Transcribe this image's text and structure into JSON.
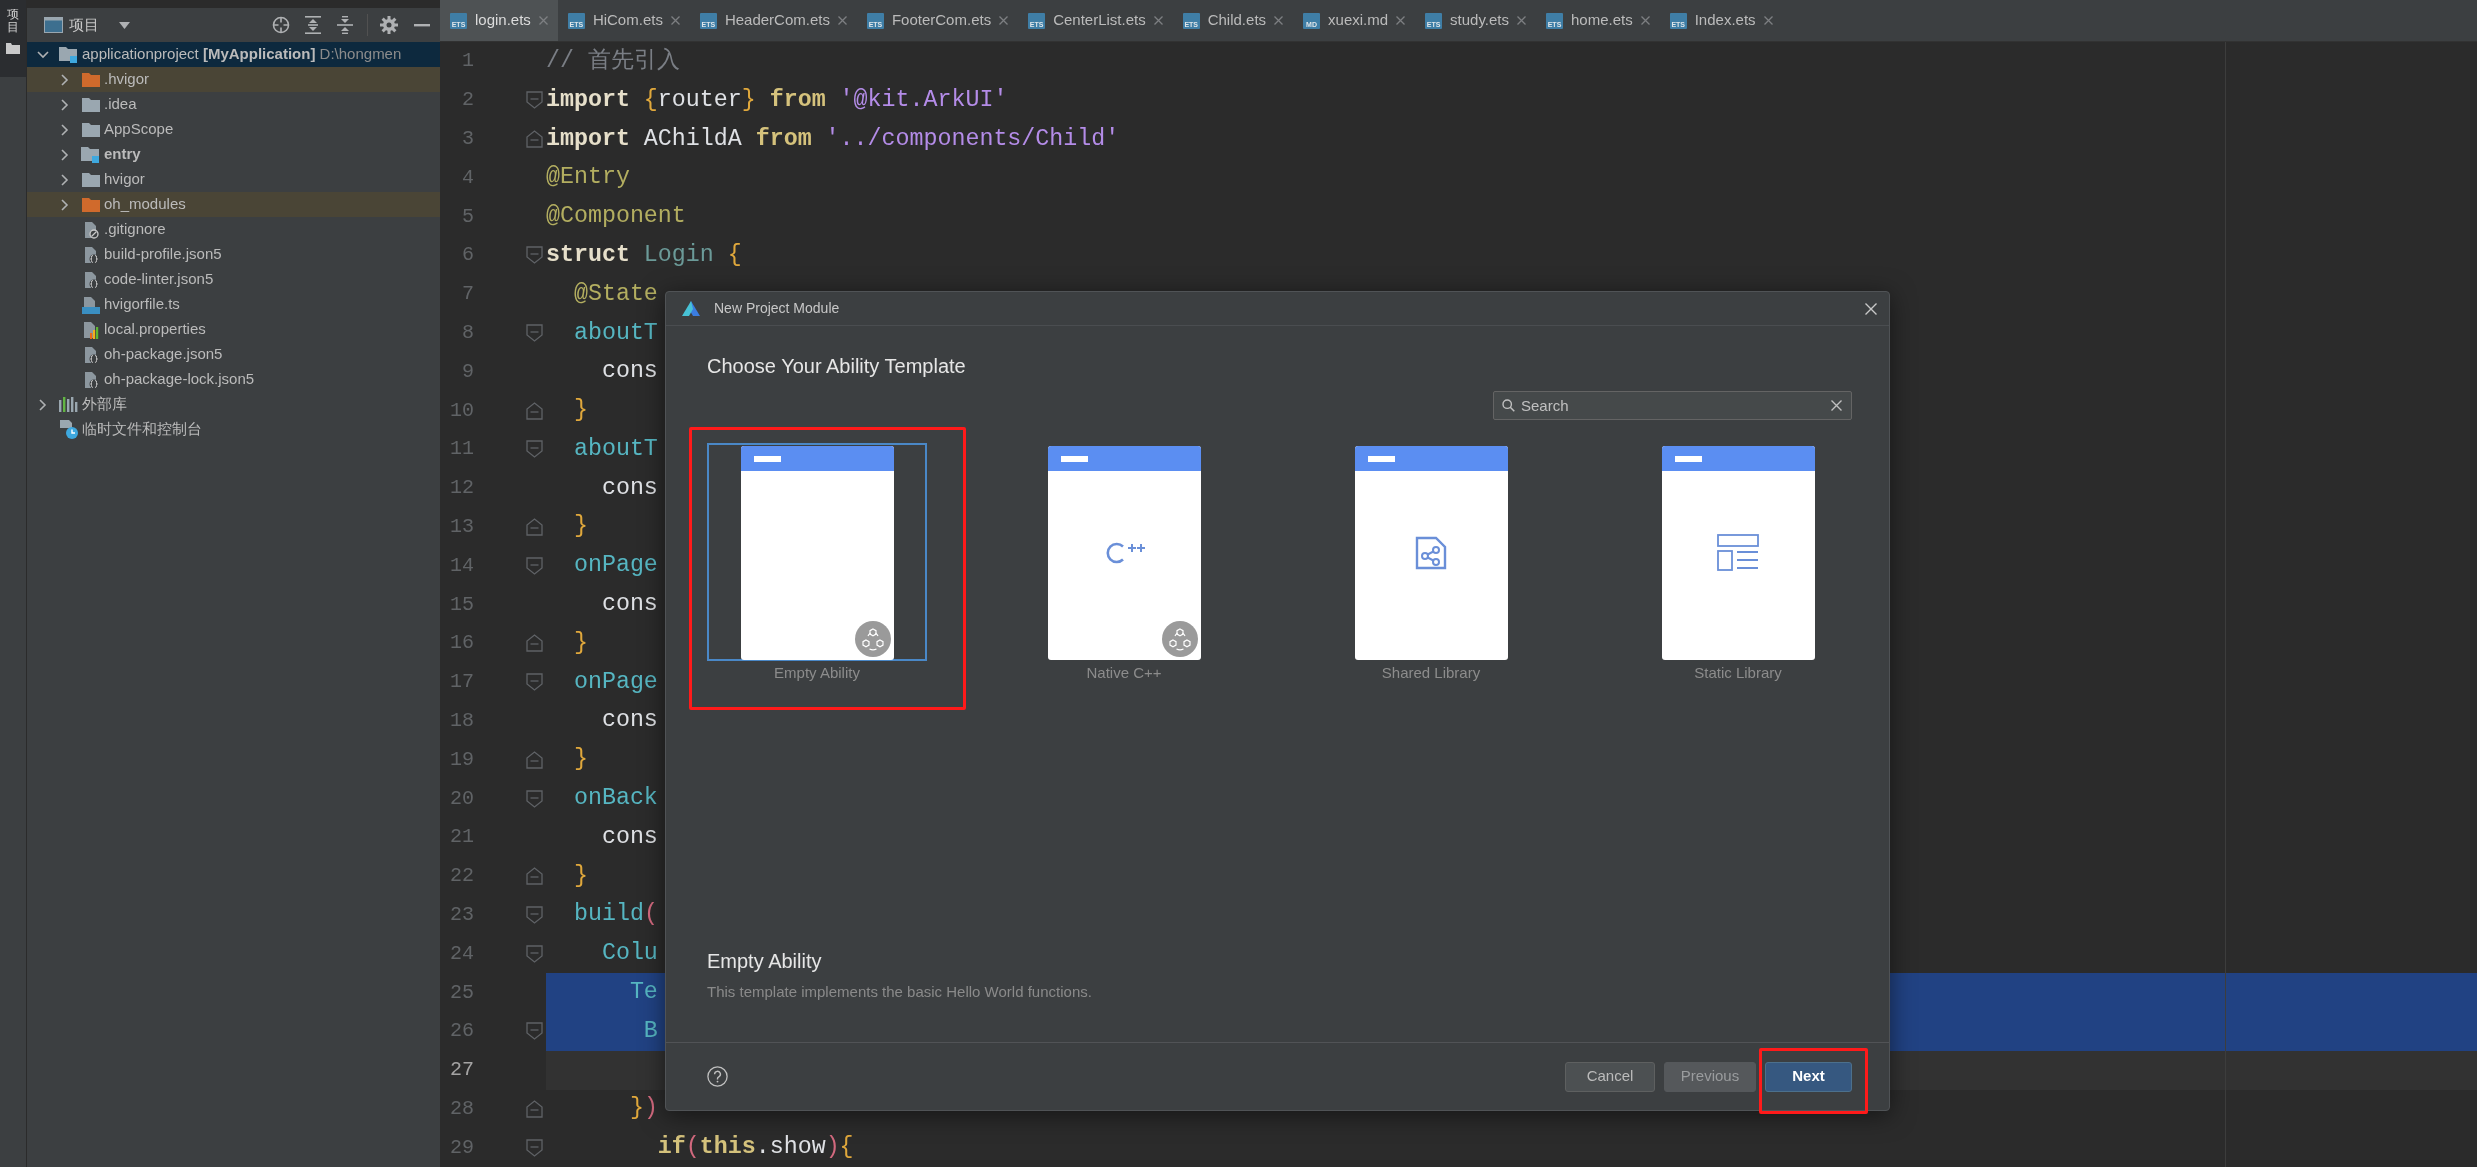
{
  "tool_strip": {
    "label": "项目",
    "selected": true
  },
  "project_panel": {
    "title": "项目",
    "tree": [
      {
        "name": "applicationproject",
        "module": "[MyApplication]",
        "path": "D:\\hongmen",
        "kind": "project",
        "expanded": true,
        "selected": true,
        "children": [
          {
            "name": ".hvigor",
            "kind": "excluded_folder",
            "expanded": false,
            "selected": false
          },
          {
            "name": ".idea",
            "kind": "folder",
            "expanded": false,
            "selected": false
          },
          {
            "name": "AppScope",
            "kind": "folder",
            "expanded": false,
            "selected": false
          },
          {
            "name": "entry",
            "kind": "module_folder",
            "expanded": false,
            "selected": false
          },
          {
            "name": "hvigor",
            "kind": "folder",
            "expanded": false,
            "selected": false
          },
          {
            "name": "oh_modules",
            "kind": "excluded_folder",
            "expanded": false,
            "selected": false
          },
          {
            "name": ".gitignore",
            "kind": "ignore_file",
            "selected": false
          },
          {
            "name": "build-profile.json5",
            "kind": "json_file",
            "selected": false
          },
          {
            "name": "code-linter.json5",
            "kind": "json_file",
            "selected": false
          },
          {
            "name": "hvigorfile.ts",
            "kind": "ts_file",
            "selected": false
          },
          {
            "name": "local.properties",
            "kind": "properties_file",
            "selected": false
          },
          {
            "name": "oh-package.json5",
            "kind": "json_file",
            "selected": false
          },
          {
            "name": "oh-package-lock.json5",
            "kind": "json_file",
            "selected": false
          }
        ]
      },
      {
        "name": "外部库",
        "kind": "library",
        "expanded": false,
        "selected": false
      },
      {
        "name": "临时文件和控制台",
        "kind": "scratch",
        "selected": false
      }
    ]
  },
  "tabs": [
    {
      "label": "login.ets",
      "type": "ETS",
      "selected": true
    },
    {
      "label": "HiCom.ets",
      "type": "ETS",
      "selected": false
    },
    {
      "label": "HeaderCom.ets",
      "type": "ETS",
      "selected": false
    },
    {
      "label": "FooterCom.ets",
      "type": "ETS",
      "selected": false
    },
    {
      "label": "CenterList.ets",
      "type": "ETS",
      "selected": false
    },
    {
      "label": "Child.ets",
      "type": "ETS",
      "selected": false
    },
    {
      "label": "xuexi.md",
      "type": "MD",
      "selected": false
    },
    {
      "label": "study.ets",
      "type": "ETS",
      "selected": false
    },
    {
      "label": "home.ets",
      "type": "ETS",
      "selected": false
    },
    {
      "label": "Index.ets",
      "type": "ETS",
      "selected": false
    }
  ],
  "code_lines": [
    {
      "number": "1",
      "kind": "plain",
      "current": false,
      "selected": false,
      "tokens": [
        {
          "text": "// 首先引入",
          "kind": "comment"
        }
      ]
    },
    {
      "number": "2",
      "kind": "fold_start",
      "current": false,
      "selected": false,
      "tokens": [
        {
          "text": "import",
          "kind": "keyword"
        },
        {
          "text": " {",
          "kind": "brace"
        },
        {
          "text": "router",
          "kind": "plain"
        },
        {
          "text": "}",
          "kind": "brace"
        },
        {
          "text": " from",
          "kind": "keyword_alt"
        },
        {
          "text": " '@kit.ArkUI'",
          "kind": "string"
        }
      ]
    },
    {
      "number": "3",
      "kind": "fold_end",
      "current": false,
      "selected": false,
      "tokens": [
        {
          "text": "import",
          "kind": "keyword"
        },
        {
          "text": " AChildA",
          "kind": "plain"
        },
        {
          "text": " from",
          "kind": "keyword_alt"
        },
        {
          "text": " '../components/Child'",
          "kind": "string"
        }
      ]
    },
    {
      "number": "4",
      "kind": "plain",
      "current": false,
      "selected": false,
      "tokens": [
        {
          "text": "@Entry",
          "kind": "decorator"
        }
      ]
    },
    {
      "number": "5",
      "kind": "plain",
      "current": false,
      "selected": false,
      "tokens": [
        {
          "text": "@Component",
          "kind": "decorator"
        }
      ]
    },
    {
      "number": "6",
      "kind": "fold_start",
      "current": false,
      "selected": false,
      "tokens": [
        {
          "text": "struct",
          "kind": "keyword"
        },
        {
          "text": " Login",
          "kind": "type_name"
        },
        {
          "text": " {",
          "kind": "brace"
        }
      ]
    },
    {
      "number": "7",
      "kind": "plain",
      "current": false,
      "selected": false,
      "tokens": [
        {
          "text": "  @State",
          "kind": "decorator"
        }
      ]
    },
    {
      "number": "8",
      "kind": "fold_start",
      "current": false,
      "selected": false,
      "tokens": [
        {
          "text": "  aboutT",
          "kind": "method"
        }
      ]
    },
    {
      "number": "9",
      "kind": "plain",
      "current": false,
      "selected": false,
      "tokens": [
        {
          "text": "    cons",
          "kind": "plain"
        }
      ]
    },
    {
      "number": "10",
      "kind": "fold_end",
      "current": false,
      "selected": false,
      "tokens": [
        {
          "text": "  }",
          "kind": "brace"
        }
      ]
    },
    {
      "number": "11",
      "kind": "fold_start",
      "current": false,
      "selected": false,
      "tokens": [
        {
          "text": "  aboutT",
          "kind": "method"
        }
      ]
    },
    {
      "number": "12",
      "kind": "plain",
      "current": false,
      "selected": false,
      "tokens": [
        {
          "text": "    cons",
          "kind": "plain"
        }
      ]
    },
    {
      "number": "13",
      "kind": "fold_end",
      "current": false,
      "selected": false,
      "tokens": [
        {
          "text": "  }",
          "kind": "brace"
        }
      ]
    },
    {
      "number": "14",
      "kind": "fold_start",
      "current": false,
      "selected": false,
      "tokens": [
        {
          "text": "  onPage",
          "kind": "method"
        }
      ]
    },
    {
      "number": "15",
      "kind": "plain",
      "current": false,
      "selected": false,
      "tokens": [
        {
          "text": "    cons",
          "kind": "plain"
        }
      ]
    },
    {
      "number": "16",
      "kind": "fold_end",
      "current": false,
      "selected": false,
      "tokens": [
        {
          "text": "  }",
          "kind": "brace"
        }
      ]
    },
    {
      "number": "17",
      "kind": "fold_start",
      "current": false,
      "selected": false,
      "tokens": [
        {
          "text": "  onPage",
          "kind": "method"
        }
      ]
    },
    {
      "number": "18",
      "kind": "plain",
      "current": false,
      "selected": false,
      "tokens": [
        {
          "text": "    cons",
          "kind": "plain"
        }
      ]
    },
    {
      "number": "19",
      "kind": "fold_end",
      "current": false,
      "selected": false,
      "tokens": [
        {
          "text": "  }",
          "kind": "brace"
        }
      ]
    },
    {
      "number": "20",
      "kind": "fold_start",
      "current": false,
      "selected": false,
      "tokens": [
        {
          "text": "  onBack",
          "kind": "method"
        }
      ]
    },
    {
      "number": "21",
      "kind": "plain",
      "current": false,
      "selected": false,
      "tokens": [
        {
          "text": "    cons",
          "kind": "plain"
        }
      ]
    },
    {
      "number": "22",
      "kind": "fold_end",
      "current": false,
      "selected": false,
      "tokens": [
        {
          "text": "  }",
          "kind": "brace"
        }
      ]
    },
    {
      "number": "23",
      "kind": "fold_start",
      "current": false,
      "selected": false,
      "tokens": [
        {
          "text": "  build",
          "kind": "method"
        },
        {
          "text": "(",
          "kind": "paren"
        }
      ]
    },
    {
      "number": "24",
      "kind": "fold_start",
      "current": false,
      "selected": false,
      "tokens": [
        {
          "text": "    Colu",
          "kind": "method"
        }
      ]
    },
    {
      "number": "25",
      "kind": "plain",
      "current": false,
      "selected": true,
      "tokens": [
        {
          "text": "      Te",
          "kind": "method"
        }
      ]
    },
    {
      "number": "26",
      "kind": "fold_start",
      "current": false,
      "selected": true,
      "tokens": [
        {
          "text": "       B",
          "kind": "method"
        }
      ]
    },
    {
      "number": "27",
      "kind": "plain",
      "current": true,
      "selected": false
    },
    {
      "number": "28",
      "kind": "fold_end",
      "current": false,
      "selected": false,
      "tokens": [
        {
          "text": "      }",
          "kind": "brace"
        },
        {
          "text": ")",
          "kind": "paren"
        }
      ]
    },
    {
      "number": "29",
      "kind": "fold_start",
      "current": false,
      "selected": false,
      "tokens": [
        {
          "text": "        if",
          "kind": "keyword_alt"
        },
        {
          "text": "(",
          "kind": "paren"
        },
        {
          "text": "this",
          "kind": "keyword_alt"
        },
        {
          "text": ".show",
          "kind": "plain"
        },
        {
          "text": ")",
          "kind": "paren"
        },
        {
          "text": "{",
          "kind": "brace"
        }
      ]
    }
  ],
  "dialog": {
    "title": "New Project Module",
    "heading": "Choose Your Ability Template",
    "search": {
      "placeholder": "Search"
    },
    "templates": [
      {
        "label": "Empty Ability",
        "kind": "empty",
        "badge": true,
        "selected": true,
        "highlighted": true
      },
      {
        "label": "Native C++",
        "kind": "cpp",
        "badge": true,
        "selected": false,
        "highlighted": false
      },
      {
        "label": "Shared Library",
        "kind": "shared",
        "badge": false,
        "selected": false,
        "highlighted": false
      },
      {
        "label": "Static Library",
        "kind": "static",
        "badge": false,
        "selected": false,
        "highlighted": false
      }
    ],
    "details": {
      "title": "Empty Ability",
      "description": "This template implements the basic Hello World functions."
    },
    "buttons": [
      {
        "label": "Cancel",
        "kind": "secondary",
        "disabled": false,
        "highlighted": false
      },
      {
        "label": "Previous",
        "kind": "secondary",
        "disabled": true,
        "highlighted": false
      },
      {
        "label": "Next",
        "kind": "primary",
        "disabled": false,
        "highlighted": true
      }
    ]
  }
}
